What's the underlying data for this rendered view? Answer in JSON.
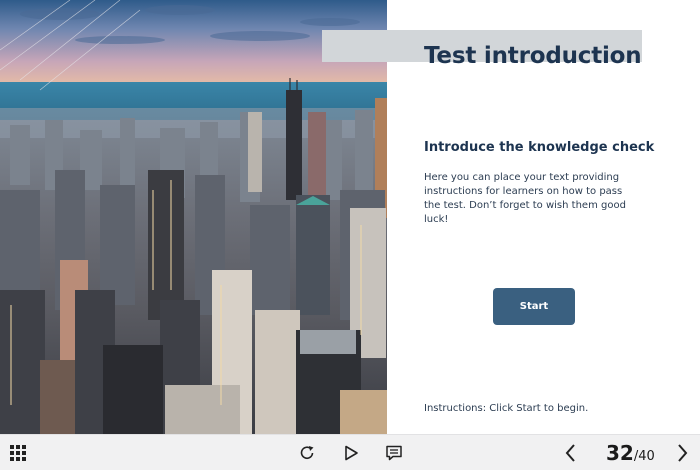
{
  "slide": {
    "title": "Test introduction",
    "subtitle": "Introduce the knowledge check",
    "body": "Here you can place your text providing instructions for learners on how to pass the test. Don’t forget to wish them good luck!",
    "start_label": "Start",
    "instructions": "Instructions: Click Start to begin."
  },
  "toolbar": {
    "menu_icon": "grid-menu-icon",
    "replay_icon": "replay-icon",
    "play_icon": "play-icon",
    "notes_icon": "notes-icon",
    "prev_icon": "chevron-left-icon",
    "next_icon": "chevron-right-icon",
    "current_page": "32",
    "separator": "/",
    "total_pages": "40"
  },
  "colors": {
    "accent": "#3a6080",
    "title": "#1d3450",
    "title_band": "#d2d6d9",
    "toolbar_bg": "#f1f1f2"
  }
}
